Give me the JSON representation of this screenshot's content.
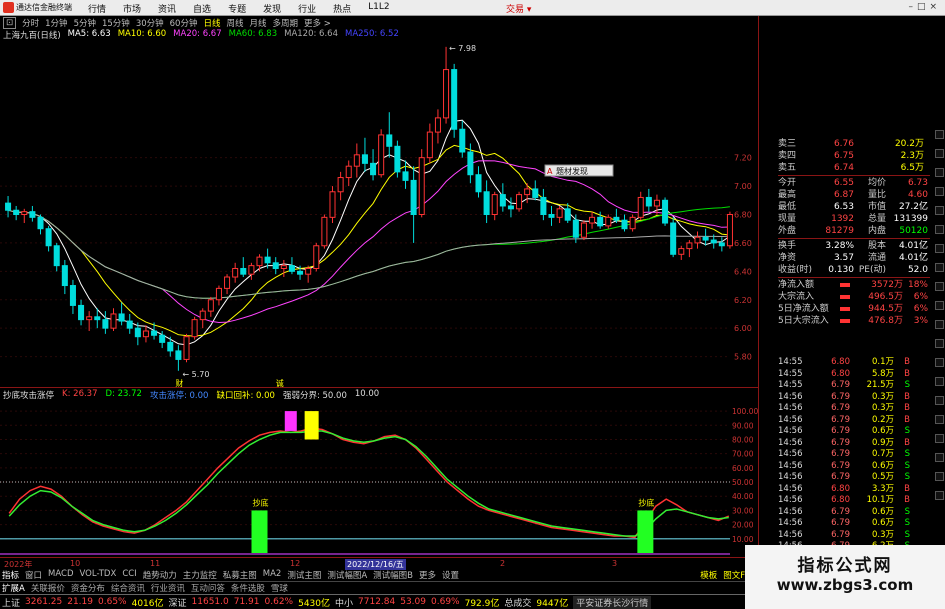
{
  "window": {
    "title": "通达信金融终端",
    "menu": [
      "行情",
      "市场",
      "资讯",
      "自选",
      "专题",
      "发现",
      "行业",
      "热点",
      "L1L2"
    ],
    "trade_button": "交易 ▾"
  },
  "period_bar": {
    "items": [
      "分时",
      "1分钟",
      "5分钟",
      "15分钟",
      "30分钟",
      "60分钟",
      "日线",
      "周线",
      "月线",
      "多周期",
      "更多 >"
    ],
    "active": "日线"
  },
  "ma_line": {
    "stock": "上海九百(日线)",
    "items": [
      {
        "label": "MA5: 6.63",
        "color": "#ffffff"
      },
      {
        "label": "MA10: 6.60",
        "color": "#ffff00"
      },
      {
        "label": "MA20: 6.67",
        "color": "#ff44ff"
      },
      {
        "label": "MA60: 6.83",
        "color": "#00dd00"
      },
      {
        "label": "MA120: 6.64",
        "color": "#aaaaaa"
      },
      {
        "label": "MA250: 6.52",
        "color": "#4444ff"
      }
    ]
  },
  "price_axis": [
    "7.20",
    "7.00",
    "6.80",
    "6.60",
    "6.40",
    "6.20",
    "6.00",
    "5.80"
  ],
  "price_annotations": {
    "high": "7.98",
    "low": "5.70",
    "marker_left": "财",
    "marker_mid": "诚"
  },
  "tooltip": {
    "icon": "A",
    "text": "题材发现"
  },
  "indicator_line": {
    "name": "抄底攻击涨停",
    "items": [
      {
        "label": "K: 26.37",
        "color": "#ff4444"
      },
      {
        "label": "D: 23.72",
        "color": "#00ff00"
      },
      {
        "label": "攻击涨停: 0.00",
        "color": "#4488ff"
      },
      {
        "label": "缺口回补: 0.00",
        "color": "#ffff00"
      },
      {
        "label": "强弱分界: 50.00",
        "color": "#dddddd"
      },
      {
        "label": "10.00",
        "color": "#dddddd"
      }
    ]
  },
  "sub_axis": [
    "100.00",
    "90.00",
    "80.00",
    "70.00",
    "60.00",
    "50.00",
    "40.00",
    "30.00",
    "20.00",
    "10.00"
  ],
  "sub_labels": {
    "signal1": "抄底",
    "signal2": "抄底"
  },
  "date_axis": [
    "2022年",
    "10",
    "11",
    "12",
    "2022/12/16/五",
    "2",
    "3"
  ],
  "tabs": [
    "指标",
    "窗口",
    "MACD",
    "VOL-TDX",
    "CCI",
    "趋势动力",
    "主力监控",
    "私募主图",
    "MA2",
    "测试主图",
    "测试幅图A",
    "测试幅图B",
    "更多",
    "设置"
  ],
  "tabs_more": "模板",
  "tab_right": "图文F10",
  "bottom_tabs": [
    "扩展A",
    "关联报价",
    "资金分布",
    "综合资讯",
    "行业资讯",
    "互动问答",
    "条件选股",
    "雪球"
  ],
  "quote": {
    "asks": [
      {
        "label": "卖三",
        "price": "6.76",
        "vol": "20.2万"
      },
      {
        "label": "卖四",
        "price": "6.75",
        "vol": "2.3万"
      },
      {
        "label": "卖五",
        "price": "6.74",
        "vol": "6.5万"
      }
    ],
    "stats": [
      {
        "l1": "今开",
        "v1": "6.55",
        "c1": "#ff4444",
        "l2": "均价",
        "v2": "6.73",
        "c2": "#ff4444"
      },
      {
        "l1": "最高",
        "v1": "6.87",
        "c1": "#ff4444",
        "l2": "量比",
        "v2": "4.60",
        "c2": "#ff4444"
      },
      {
        "l1": "最低",
        "v1": "6.53",
        "c1": "#ffffff",
        "l2": "市值",
        "v2": "27.2亿",
        "c2": "#ffffff"
      },
      {
        "l1": "现量",
        "v1": "1392",
        "c1": "#ff4444",
        "l2": "总量",
        "v2": "131399",
        "c2": "#ffffff"
      },
      {
        "l1": "外盘",
        "v1": "81279",
        "c1": "#ff4444",
        "l2": "内盘",
        "v2": "50120",
        "c2": "#00ff00"
      }
    ],
    "stats2": [
      {
        "l1": "换手",
        "v1": "3.28%",
        "c1": "#ffffff",
        "l2": "股本",
        "v2": "4.01亿",
        "c2": "#ffffff"
      },
      {
        "l1": "净资",
        "v1": "3.57",
        "c1": "#ffffff",
        "l2": "流通",
        "v2": "4.01亿",
        "c2": "#ffffff"
      },
      {
        "l1": "收益(时)",
        "v1": "0.130",
        "c1": "#ffffff",
        "l2": "PE(动)",
        "v2": "52.0",
        "c2": "#ffffff"
      }
    ],
    "flows": [
      {
        "label": "净流入额",
        "value": "3572万",
        "pct": "18%"
      },
      {
        "label": "大宗流入",
        "value": "496.5万",
        "pct": "6%"
      },
      {
        "label": "5日净流入额",
        "value": "944.5万",
        "pct": "6%"
      },
      {
        "label": "5日大宗流入",
        "value": "476.8万",
        "pct": "3%"
      }
    ]
  },
  "ticks": [
    {
      "t": "14:55",
      "p": "6.80",
      "v": "0.1万",
      "d": "B"
    },
    {
      "t": "14:55",
      "p": "6.80",
      "v": "5.8万",
      "d": "B"
    },
    {
      "t": "14:55",
      "p": "6.79",
      "v": "21.5万",
      "d": "S"
    },
    {
      "t": "14:56",
      "p": "6.79",
      "v": "0.3万",
      "d": "B"
    },
    {
      "t": "14:56",
      "p": "6.79",
      "v": "0.3万",
      "d": "B"
    },
    {
      "t": "14:56",
      "p": "6.79",
      "v": "0.2万",
      "d": "B"
    },
    {
      "t": "14:56",
      "p": "6.79",
      "v": "0.6万",
      "d": "S"
    },
    {
      "t": "14:56",
      "p": "6.79",
      "v": "0.9万",
      "d": "B"
    },
    {
      "t": "14:56",
      "p": "6.79",
      "v": "0.7万",
      "d": "S"
    },
    {
      "t": "14:56",
      "p": "6.79",
      "v": "0.6万",
      "d": "S"
    },
    {
      "t": "14:56",
      "p": "6.79",
      "v": "0.5万",
      "d": "S"
    },
    {
      "t": "14:56",
      "p": "6.80",
      "v": "3.3万",
      "d": "B"
    },
    {
      "t": "14:56",
      "p": "6.80",
      "v": "10.1万",
      "d": "B"
    },
    {
      "t": "14:56",
      "p": "6.79",
      "v": "0.6万",
      "d": "S"
    },
    {
      "t": "14:56",
      "p": "6.79",
      "v": "0.6万",
      "d": "S"
    },
    {
      "t": "14:56",
      "p": "6.79",
      "v": "0.3万",
      "d": "S"
    },
    {
      "t": "14:56",
      "p": "6.79",
      "v": "6.2万",
      "d": "S"
    },
    {
      "t": "14:56",
      "p": "6.79",
      "v": "0.4万",
      "d": "S"
    }
  ],
  "statusbar": {
    "items": [
      {
        "name": "上证",
        "value": "3261.25",
        "chg": "21.19",
        "pct": "0.65%",
        "amount": "4016亿"
      },
      {
        "name": "深证",
        "value": "11651.0",
        "chg": "71.91",
        "pct": "0.62%",
        "amount": "5430亿"
      },
      {
        "name": "中小",
        "value": "7712.84",
        "chg": "53.09",
        "pct": "0.69%",
        "amount": "792.9亿"
      }
    ],
    "total_label": "总成交",
    "total": "9447亿",
    "news": "平安证券长沙行情"
  },
  "watermark": {
    "line1": "指标公式网",
    "line2": "www.zbgs3.com"
  },
  "colors": {
    "up": "#ff3333",
    "down": "#00dddd",
    "k_line": "#ff3333",
    "d_line": "#33ee33",
    "signal_bar": "#22ff22",
    "magenta": "#ff33ff",
    "yellow": "#ffff00"
  },
  "chart_data": {
    "type": "candlestick",
    "ylim": [
      5.6,
      8.0
    ],
    "candles": [
      [
        6.88,
        6.93,
        6.78,
        6.83
      ],
      [
        6.83,
        6.86,
        6.76,
        6.8
      ],
      [
        6.8,
        6.84,
        6.74,
        6.82
      ],
      [
        6.82,
        6.86,
        6.75,
        6.78
      ],
      [
        6.78,
        6.8,
        6.66,
        6.7
      ],
      [
        6.7,
        6.72,
        6.54,
        6.58
      ],
      [
        6.58,
        6.6,
        6.4,
        6.44
      ],
      [
        6.44,
        6.48,
        6.24,
        6.3
      ],
      [
        6.3,
        6.34,
        6.1,
        6.16
      ],
      [
        6.16,
        6.2,
        6.02,
        6.06
      ],
      [
        6.06,
        6.12,
        5.98,
        6.08
      ],
      [
        6.08,
        6.14,
        6.0,
        6.06
      ],
      [
        6.06,
        6.12,
        5.96,
        6.0
      ],
      [
        6.0,
        6.14,
        5.98,
        6.1
      ],
      [
        6.1,
        6.18,
        6.02,
        6.05
      ],
      [
        6.05,
        6.1,
        5.96,
        6.0
      ],
      [
        6.0,
        6.04,
        5.88,
        5.94
      ],
      [
        5.94,
        6.02,
        5.9,
        5.98
      ],
      [
        5.98,
        6.04,
        5.92,
        5.95
      ],
      [
        5.95,
        5.98,
        5.86,
        5.9
      ],
      [
        5.9,
        5.94,
        5.8,
        5.84
      ],
      [
        5.84,
        5.88,
        5.7,
        5.78
      ],
      [
        5.78,
        5.96,
        5.76,
        5.94
      ],
      [
        5.94,
        6.08,
        5.92,
        6.06
      ],
      [
        6.06,
        6.14,
        6.0,
        6.12
      ],
      [
        6.12,
        6.22,
        6.08,
        6.2
      ],
      [
        6.2,
        6.3,
        6.16,
        6.28
      ],
      [
        6.28,
        6.38,
        6.24,
        6.36
      ],
      [
        6.36,
        6.46,
        6.32,
        6.42
      ],
      [
        6.42,
        6.5,
        6.36,
        6.38
      ],
      [
        6.38,
        6.46,
        6.34,
        6.44
      ],
      [
        6.44,
        6.52,
        6.4,
        6.5
      ],
      [
        6.5,
        6.56,
        6.42,
        6.46
      ],
      [
        6.46,
        6.5,
        6.38,
        6.42
      ],
      [
        6.42,
        6.48,
        6.36,
        6.44
      ],
      [
        6.44,
        6.5,
        6.38,
        6.4
      ],
      [
        6.4,
        6.44,
        6.34,
        6.38
      ],
      [
        6.38,
        6.44,
        6.32,
        6.42
      ],
      [
        6.42,
        6.6,
        6.4,
        6.58
      ],
      [
        6.58,
        6.8,
        6.56,
        6.78
      ],
      [
        6.78,
        7.0,
        6.74,
        6.96
      ],
      [
        6.96,
        7.1,
        6.9,
        7.06
      ],
      [
        7.06,
        7.18,
        7.0,
        7.14
      ],
      [
        7.14,
        7.3,
        7.06,
        7.22
      ],
      [
        7.22,
        7.34,
        7.1,
        7.16
      ],
      [
        7.16,
        7.26,
        7.04,
        7.08
      ],
      [
        7.08,
        7.4,
        7.06,
        7.36
      ],
      [
        7.36,
        7.52,
        7.2,
        7.28
      ],
      [
        7.28,
        7.32,
        7.06,
        7.1
      ],
      [
        7.1,
        7.18,
        6.98,
        7.04
      ],
      [
        7.04,
        7.14,
        6.6,
        6.8
      ],
      [
        6.8,
        7.26,
        6.78,
        7.2
      ],
      [
        7.2,
        7.44,
        7.16,
        7.38
      ],
      [
        7.38,
        7.54,
        7.3,
        7.48
      ],
      [
        7.48,
        7.98,
        7.44,
        7.82
      ],
      [
        7.82,
        7.86,
        7.34,
        7.4
      ],
      [
        7.4,
        7.46,
        7.2,
        7.24
      ],
      [
        7.24,
        7.3,
        7.02,
        7.08
      ],
      [
        7.08,
        7.14,
        6.92,
        6.96
      ],
      [
        6.96,
        7.04,
        6.74,
        6.8
      ],
      [
        6.8,
        6.96,
        6.76,
        6.94
      ],
      [
        6.94,
        7.02,
        6.82,
        6.86
      ],
      [
        6.86,
        6.92,
        6.78,
        6.84
      ],
      [
        6.84,
        6.96,
        6.82,
        6.94
      ],
      [
        6.94,
        7.02,
        6.88,
        6.98
      ],
      [
        6.98,
        7.04,
        6.9,
        6.92
      ],
      [
        6.92,
        6.98,
        6.76,
        6.8
      ],
      [
        6.8,
        6.86,
        6.72,
        6.78
      ],
      [
        6.78,
        6.86,
        6.74,
        6.84
      ],
      [
        6.84,
        6.88,
        6.74,
        6.76
      ],
      [
        6.76,
        6.8,
        6.6,
        6.64
      ],
      [
        6.64,
        6.76,
        6.62,
        6.74
      ],
      [
        6.74,
        6.82,
        6.7,
        6.78
      ],
      [
        6.78,
        6.82,
        6.7,
        6.72
      ],
      [
        6.72,
        6.8,
        6.7,
        6.78
      ],
      [
        6.78,
        6.84,
        6.74,
        6.76
      ],
      [
        6.76,
        6.8,
        6.68,
        6.7
      ],
      [
        6.7,
        6.8,
        6.68,
        6.78
      ],
      [
        6.78,
        6.96,
        6.76,
        6.92
      ],
      [
        6.92,
        6.98,
        6.82,
        6.86
      ],
      [
        6.86,
        6.94,
        6.8,
        6.9
      ],
      [
        6.9,
        6.92,
        6.72,
        6.74
      ],
      [
        6.74,
        6.78,
        6.5,
        6.52
      ],
      [
        6.52,
        6.58,
        6.48,
        6.56
      ],
      [
        6.56,
        6.62,
        6.5,
        6.6
      ],
      [
        6.6,
        6.68,
        6.56,
        6.64
      ],
      [
        6.64,
        6.7,
        6.58,
        6.62
      ],
      [
        6.62,
        6.66,
        6.56,
        6.6
      ],
      [
        6.6,
        6.64,
        6.54,
        6.58
      ],
      [
        6.58,
        6.82,
        6.56,
        6.8
      ]
    ],
    "k_values": [
      28,
      38,
      44,
      47,
      45,
      40,
      33,
      27,
      22,
      19,
      17,
      15,
      14,
      16,
      20,
      25,
      30,
      36,
      44,
      52,
      60,
      67,
      74,
      79,
      83,
      85,
      86,
      85,
      86,
      88,
      87,
      84,
      80,
      78,
      77,
      79,
      82,
      83,
      80,
      74,
      66,
      58,
      50,
      44,
      38,
      33,
      30,
      28,
      26,
      24,
      22,
      20,
      18,
      17,
      16,
      15,
      14,
      13,
      12,
      12,
      11,
      22,
      33,
      38,
      34,
      29,
      27,
      25,
      23,
      26
    ],
    "d_values": [
      26,
      34,
      40,
      44,
      43,
      39,
      33,
      28,
      23,
      20,
      18,
      16,
      15,
      16,
      19,
      23,
      28,
      34,
      41,
      48,
      56,
      63,
      70,
      76,
      80,
      83,
      85,
      85,
      85,
      86,
      86,
      84,
      81,
      79,
      78,
      79,
      81,
      82,
      80,
      75,
      68,
      60,
      52,
      46,
      40,
      35,
      31,
      29,
      27,
      25,
      23,
      21,
      19,
      18,
      17,
      16,
      15,
      14,
      13,
      12,
      12,
      16,
      24,
      30,
      31,
      29,
      27,
      25,
      24,
      25
    ],
    "signals": [
      {
        "index": 24,
        "type": "抄底"
      },
      {
        "index": 61,
        "type": "抄底"
      }
    ]
  }
}
